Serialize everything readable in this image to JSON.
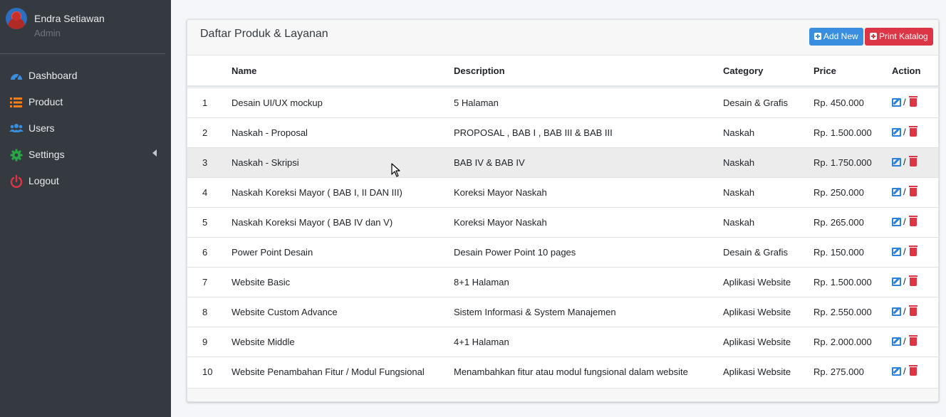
{
  "user": {
    "name": "Endra Setiawan",
    "role": "Admin"
  },
  "nav": [
    {
      "label": "Dashboard",
      "icon": "dashboard-icon",
      "color": "#3a8ee0"
    },
    {
      "label": "Product",
      "icon": "list-icon",
      "color": "#fd7e14"
    },
    {
      "label": "Users",
      "icon": "users-icon",
      "color": "#3a8ee0"
    },
    {
      "label": "Settings",
      "icon": "gear-icon",
      "color": "#28a745"
    },
    {
      "label": "Logout",
      "icon": "power-icon",
      "color": "#dc3545"
    }
  ],
  "card": {
    "title": "Daftar Produk & Layanan",
    "add_label": "Add New",
    "print_label": "Print Katalog"
  },
  "table": {
    "headers": {
      "name": "Name",
      "description": "Description",
      "category": "Category",
      "price": "Price",
      "action": "Action"
    },
    "rows": [
      {
        "no": "1",
        "name": "Desain UI/UX mockup",
        "description": "5 Halaman",
        "category": "Desain & Grafis",
        "price": "Rp. 450.000"
      },
      {
        "no": "2",
        "name": "Naskah - Proposal",
        "description": "PROPOSAL , BAB I , BAB III & BAB III",
        "category": "Naskah",
        "price": "Rp. 1.500.000"
      },
      {
        "no": "3",
        "name": "Naskah - Skripsi",
        "description": "BAB IV & BAB IV",
        "category": "Naskah",
        "price": "Rp. 1.750.000"
      },
      {
        "no": "4",
        "name": "Naskah Koreksi Mayor ( BAB I, II DAN III)",
        "description": "Koreksi Mayor Naskah",
        "category": "Naskah",
        "price": "Rp. 250.000"
      },
      {
        "no": "5",
        "name": "Naskah Koreksi Mayor ( BAB IV dan V)",
        "description": "Koreksi Mayor Naskah",
        "category": "Naskah",
        "price": "Rp. 265.000"
      },
      {
        "no": "6",
        "name": "Power Point Desain",
        "description": "Desain Power Point 10 pages",
        "category": "Desain & Grafis",
        "price": "Rp. 150.000"
      },
      {
        "no": "7",
        "name": "Website Basic",
        "description": "8+1 Halaman",
        "category": "Aplikasi Website",
        "price": "Rp. 1.500.000"
      },
      {
        "no": "8",
        "name": "Website Custom Advance",
        "description": "Sistem Informasi & System Manajemen",
        "category": "Aplikasi Website",
        "price": "Rp. 2.550.000"
      },
      {
        "no": "9",
        "name": "Website Middle",
        "description": "4+1 Halaman",
        "category": "Aplikasi Website",
        "price": "Rp. 2.000.000"
      },
      {
        "no": "10",
        "name": "Website Penambahan Fitur / Modul Fungsional",
        "description": "Menambahkan fitur atau modul fungsional dalam website",
        "category": "Aplikasi Website",
        "price": "Rp. 275.000"
      }
    ]
  },
  "action_separator": "/",
  "colors": {
    "sidebar": "#343a40",
    "primary": "#3a8ee0",
    "danger": "#dc3545"
  }
}
